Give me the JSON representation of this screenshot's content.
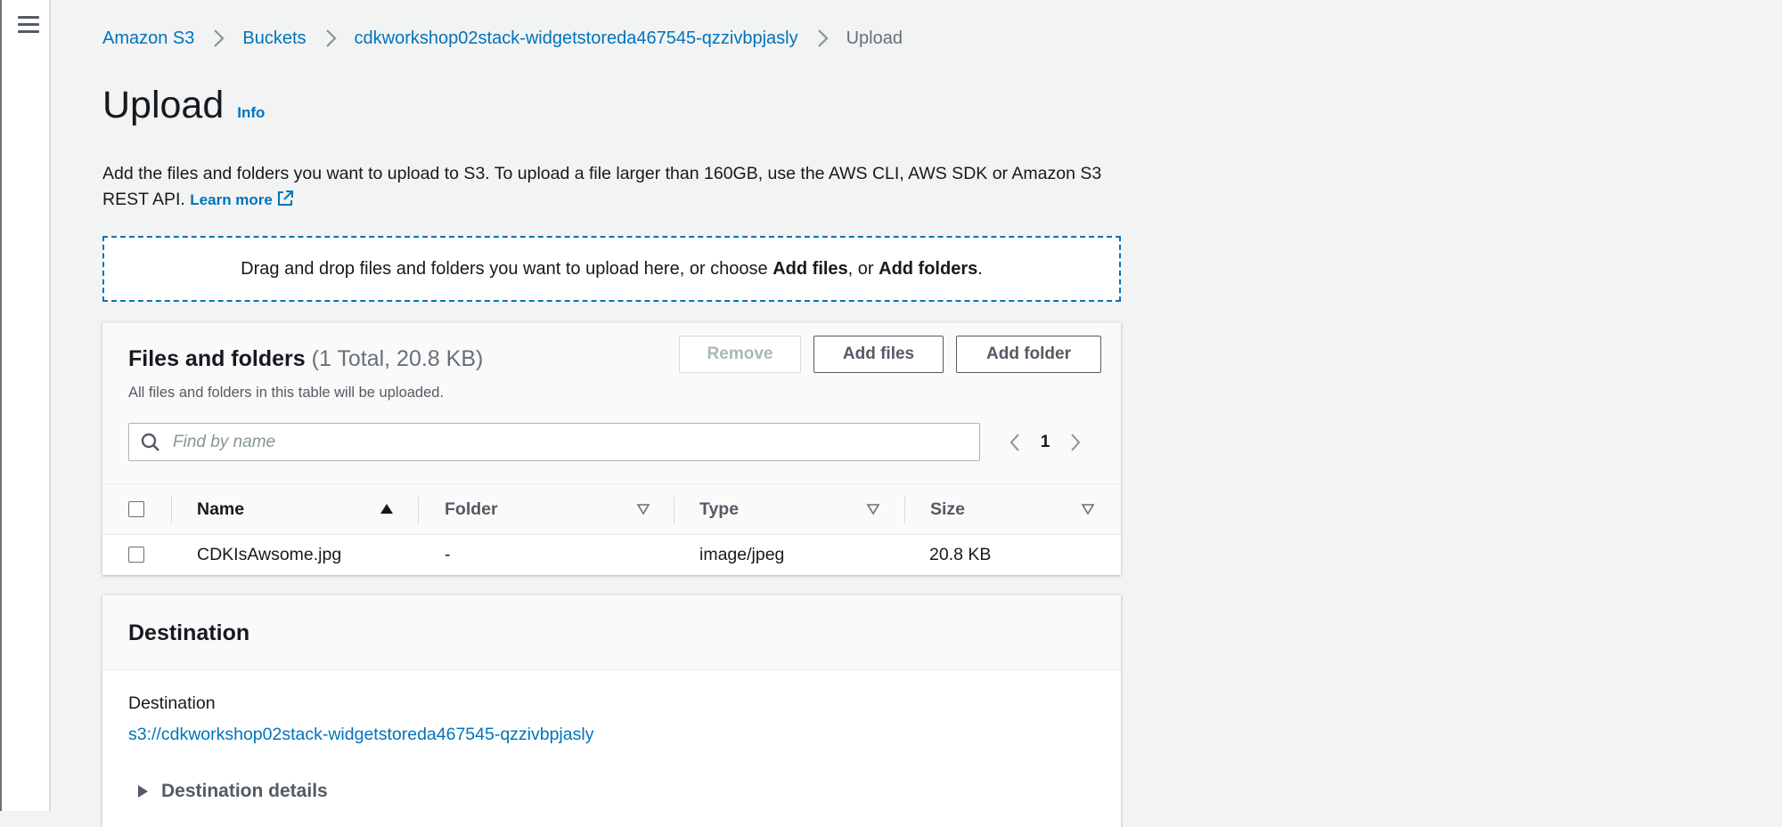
{
  "breadcrumb": {
    "items": [
      "Amazon S3",
      "Buckets",
      "cdkworkshop02stack-widgetstoreda467545-qzzivbpjasly"
    ],
    "current": "Upload"
  },
  "page": {
    "title": "Upload",
    "info_label": "Info",
    "description": "Add the files and folders you want to upload to S3. To upload a file larger than 160GB, use the AWS CLI, AWS SDK or Amazon S3 REST API.",
    "learn_more": "Learn more"
  },
  "dropzone": {
    "text_prefix": "Drag and drop files and folders you want to upload here, or choose ",
    "add_files": "Add files",
    "text_mid": ", or ",
    "add_folders": "Add folders",
    "text_suffix": "."
  },
  "files_panel": {
    "title": "Files and folders",
    "count": "(1 Total, 20.8 KB)",
    "subtitle": "All files and folders in this table will be uploaded.",
    "buttons": {
      "remove": "Remove",
      "add_files": "Add files",
      "add_folder": "Add folder"
    },
    "search_placeholder": "Find by name",
    "page": "1",
    "columns": [
      "Name",
      "Folder",
      "Type",
      "Size"
    ],
    "rows": [
      {
        "name": "CDKIsAwsome.jpg",
        "folder": "-",
        "type": "image/jpeg",
        "size": "20.8 KB"
      }
    ]
  },
  "destination_panel": {
    "title": "Destination",
    "label": "Destination",
    "uri": "s3://cdkworkshop02stack-widgetstoreda467545-qzzivbpjasly",
    "details_label": "Destination details"
  },
  "colors": {
    "link": "#0073bb",
    "background": "#f2f3f3",
    "text": "#16191f",
    "muted": "#687078"
  }
}
